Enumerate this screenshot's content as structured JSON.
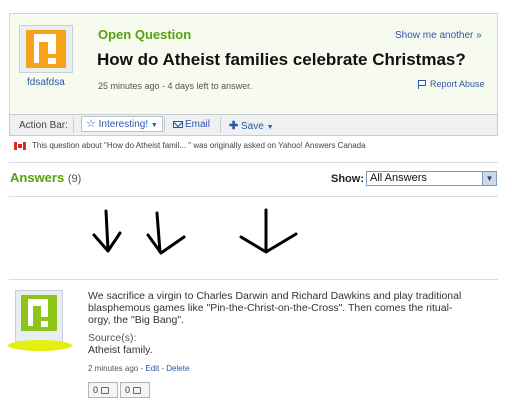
{
  "question": {
    "status_label": "Open Question",
    "title": "How do Atheist families celebrate Christmas?",
    "asker_name": "fdsafdsa",
    "meta": "25 minutes ago - 4 days left to answer.",
    "show_another": "Show me another »",
    "report_abuse": "Report Abuse"
  },
  "action_bar": {
    "label": "Action Bar:",
    "interesting": "Interesting!",
    "email": "Email",
    "save": "Save"
  },
  "notice": "This question about \"How do Atheist famil... \" was originally asked on Yahoo! Answers Canada",
  "answers": {
    "heading": "Answers",
    "count": "(9)",
    "show_label": "Show:",
    "filter_value": "All Answers"
  },
  "answer": {
    "body": "We sacrifice a virgin to Charles Darwin and Richard Dawkins and play traditional blasphemous games like \"Pin-the-Christ-on-the-Cross\". Then comes the ritual-orgy, the \"Big Bang\".",
    "sources_label": "Source(s):",
    "source_text": "Atheist family.",
    "time": "2 minutes ago",
    "edit": "Edit",
    "delete": "Delete",
    "thumbs_up_count": "0",
    "thumbs_down_count": "0"
  },
  "colors": {
    "accent_green": "#57a20f",
    "link_blue": "#2b58a8",
    "asker_avatar": "#f6a21a",
    "answerer_avatar": "#8cc41a",
    "highlight_yellow": "#e6ef12"
  }
}
